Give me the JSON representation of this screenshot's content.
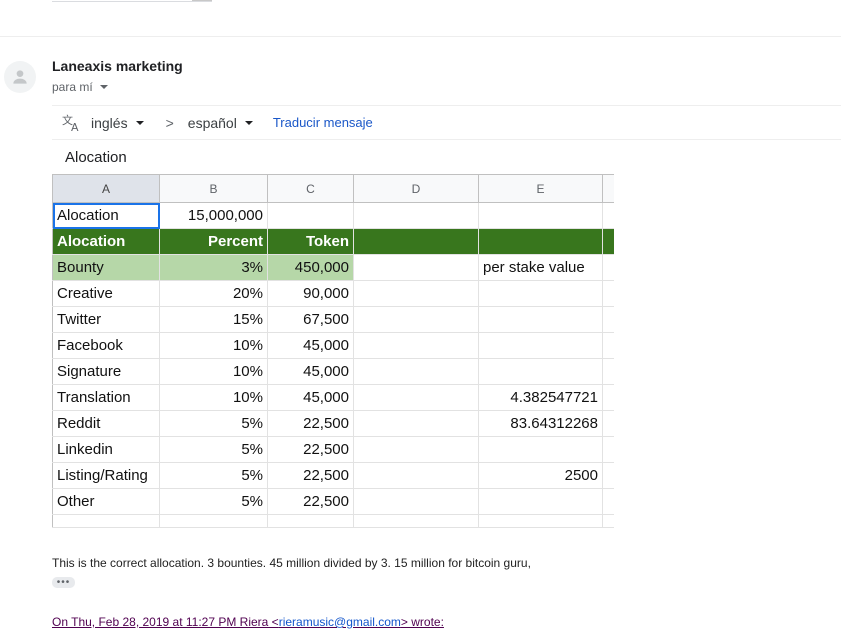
{
  "message": {
    "sender": "Laneaxis marketing",
    "recipient": "para mí",
    "body_heading": "Alocation",
    "text": "This is the correct allocation. 3 bounties. 45 million divided by 3. 15 million for bitcoin guru,",
    "ellipsis": "•••",
    "quote": {
      "prefix": "On Thu, Feb 28, 2019 at 11:27 PM Riera <",
      "email": "rieramusic@gmail.com",
      "suffix": "> wrote:"
    }
  },
  "translate": {
    "from": "inglés",
    "arrow": ">",
    "to": "español",
    "action": "Traducir mensaje"
  },
  "sheet": {
    "columns": [
      "A",
      "B",
      "C",
      "D",
      "E"
    ],
    "rows": [
      [
        "Alocation",
        "15,000,000",
        "",
        "",
        ""
      ],
      [
        "Alocation",
        "Percent",
        "Token",
        "",
        ""
      ],
      [
        "Bounty",
        "3%",
        "450,000",
        "",
        "per stake value"
      ],
      [
        "Creative",
        "20%",
        "90,000",
        "",
        ""
      ],
      [
        "Twitter",
        "15%",
        "67,500",
        "",
        ""
      ],
      [
        "Facebook",
        "10%",
        "45,000",
        "",
        ""
      ],
      [
        "Signature",
        "10%",
        "45,000",
        "",
        ""
      ],
      [
        "Translation",
        "10%",
        "45,000",
        "",
        "4.382547721"
      ],
      [
        "Reddit",
        "5%",
        "22,500",
        "",
        "83.64312268"
      ],
      [
        "Linkedin",
        "5%",
        "22,500",
        "",
        ""
      ],
      [
        "Listing/Rating",
        "5%",
        "22,500",
        "",
        "2500"
      ],
      [
        "Other",
        "5%",
        "22,500",
        "",
        ""
      ]
    ],
    "colors": {
      "header_green": "#38761d",
      "highlight_green": "#b6d7a8",
      "selection_blue": "#1a73e8"
    }
  },
  "colors": {
    "link": "#1155cc",
    "quote": "#500050"
  }
}
